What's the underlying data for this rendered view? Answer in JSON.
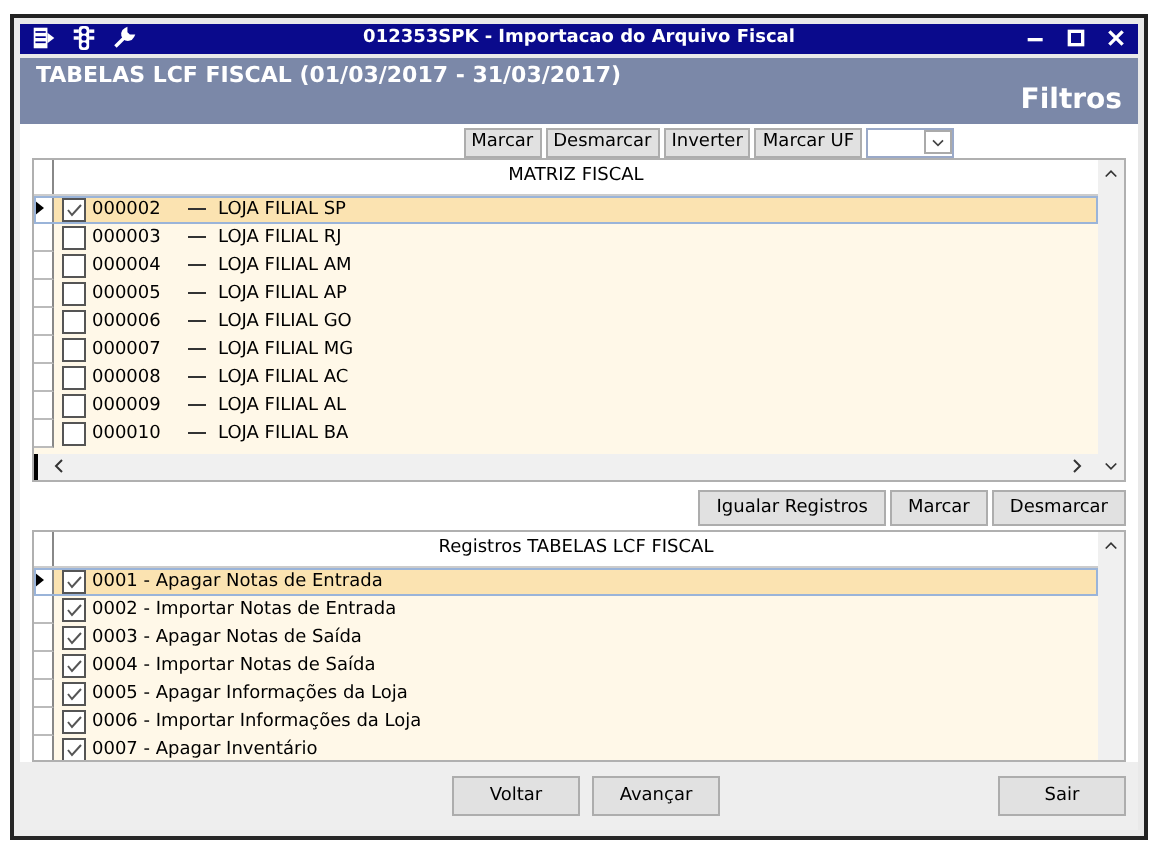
{
  "window": {
    "title": "012353SPK - Importacao do Arquivo Fiscal"
  },
  "header": {
    "title": "TABELAS LCF FISCAL (01/03/2017 - 31/03/2017)",
    "subtitle": "Filtros"
  },
  "top_toolbar": {
    "buttons": [
      "Marcar",
      "Desmarcar",
      "Inverter",
      "Marcar UF"
    ]
  },
  "matriz_grid": {
    "column": "MATRIZ FISCAL",
    "rows": [
      {
        "code": "000002",
        "name": "LOJA FILIAL SP",
        "checked": true,
        "selected": true
      },
      {
        "code": "000003",
        "name": "LOJA FILIAL RJ",
        "checked": false,
        "selected": false
      },
      {
        "code": "000004",
        "name": "LOJA FILIAL AM",
        "checked": false,
        "selected": false
      },
      {
        "code": "000005",
        "name": "LOJA FILIAL AP",
        "checked": false,
        "selected": false
      },
      {
        "code": "000006",
        "name": "LOJA FILIAL GO",
        "checked": false,
        "selected": false
      },
      {
        "code": "000007",
        "name": "LOJA FILIAL MG",
        "checked": false,
        "selected": false
      },
      {
        "code": "000008",
        "name": "LOJA FILIAL AC",
        "checked": false,
        "selected": false
      },
      {
        "code": "000009",
        "name": "LOJA FILIAL AL",
        "checked": false,
        "selected": false
      },
      {
        "code": "000010",
        "name": "LOJA FILIAL BA",
        "checked": false,
        "selected": false
      }
    ]
  },
  "middle_toolbar": {
    "buttons": [
      "Igualar Registros",
      "Marcar",
      "Desmarcar"
    ]
  },
  "registros_grid": {
    "column": "Registros TABELAS LCF FISCAL",
    "rows": [
      {
        "label": "0001 - Apagar Notas de Entrada",
        "checked": true,
        "selected": true
      },
      {
        "label": "0002 - Importar Notas de Entrada",
        "checked": true,
        "selected": false
      },
      {
        "label": "0003 - Apagar Notas de Saída",
        "checked": true,
        "selected": false
      },
      {
        "label": "0004 - Importar Notas de Saída",
        "checked": true,
        "selected": false
      },
      {
        "label": "0005 - Apagar Informações da Loja",
        "checked": true,
        "selected": false
      },
      {
        "label": "0006 - Importar Informações da Loja",
        "checked": true,
        "selected": false
      },
      {
        "label": "0007 - Apagar Inventário",
        "checked": true,
        "selected": false
      }
    ]
  },
  "footer": {
    "buttons": [
      "Voltar",
      "Avançar",
      "Sair"
    ]
  }
}
